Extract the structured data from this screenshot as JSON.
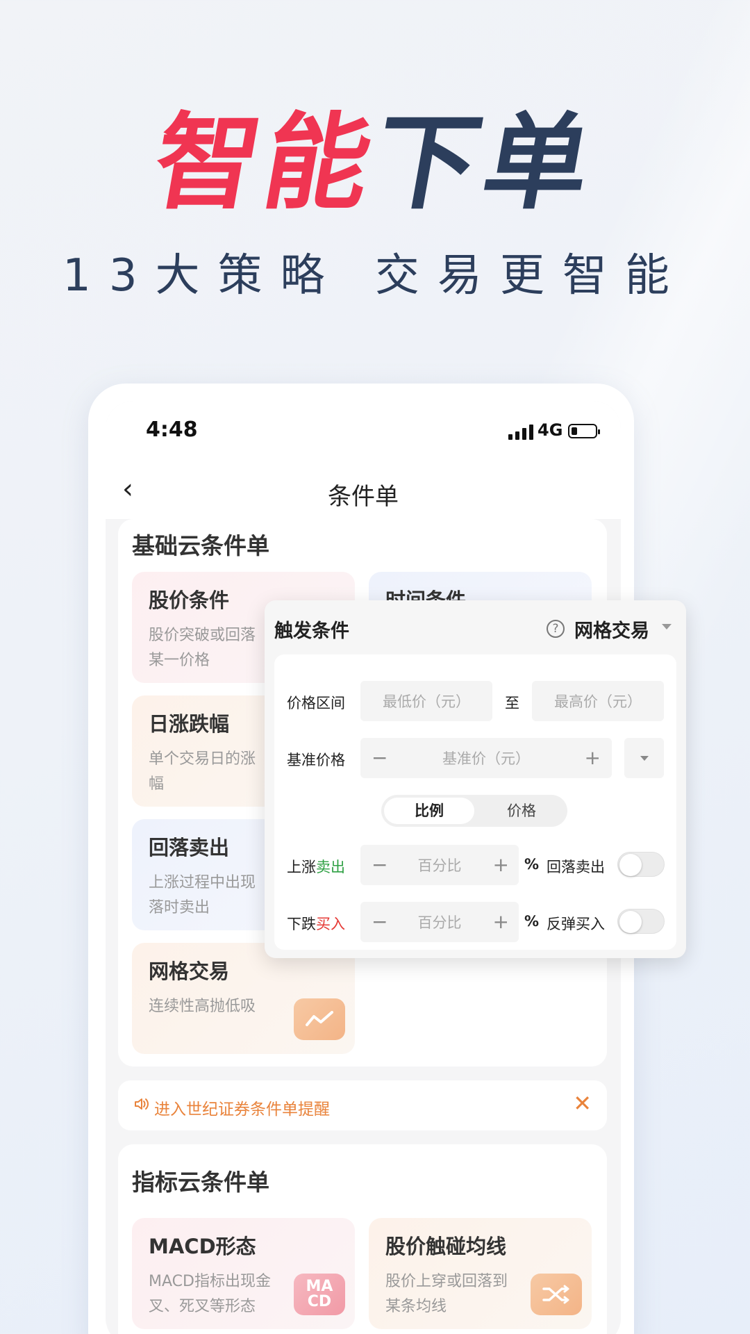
{
  "headline": {
    "red": "智能",
    "dark": "下单"
  },
  "subline": "13大策略 交易更智能",
  "status": {
    "time": "4:48",
    "network": "4G"
  },
  "nav": {
    "title": "条件单"
  },
  "basic": {
    "title": "基础云条件单",
    "tiles": [
      {
        "title": "股价条件",
        "desc": "股价突破或回落\n某一价格"
      },
      {
        "title": "时间条件",
        "desc": ""
      },
      {
        "title": "日涨跌幅",
        "desc": "单个交易日的涨\n幅"
      },
      {
        "title": "回落卖出",
        "desc": "上涨过程中出现\n落时卖出"
      },
      {
        "title": "网格交易",
        "desc": "连续性高抛低吸"
      }
    ]
  },
  "notice": {
    "text": "进入世纪证券条件单提醒"
  },
  "indicator": {
    "title": "指标云条件单",
    "tiles": [
      {
        "title": "MACD形态",
        "desc": "MACD指标出现金\n叉、死叉等形态",
        "icon": "MA\nCD"
      },
      {
        "title": "股价触碰均线",
        "desc": "股价上穿或回落到\n某条均线"
      }
    ]
  },
  "panel": {
    "title": "触发条件",
    "mode": "网格交易",
    "price_range_label": "价格区间",
    "min_placeholder": "最低价（元）",
    "to": "至",
    "max_placeholder": "最高价（元）",
    "base_label": "基准价格",
    "base_placeholder": "基准价（元）",
    "seg_on": "比例",
    "seg_off": "价格",
    "up_label_a": "上涨",
    "up_label_b": "卖出",
    "down_label_a": "下跌",
    "down_label_b": "买入",
    "pct_placeholder": "百分比",
    "pct_unit": "%",
    "up_toggle_label": "回落卖出",
    "down_toggle_label": "反弹买入"
  }
}
